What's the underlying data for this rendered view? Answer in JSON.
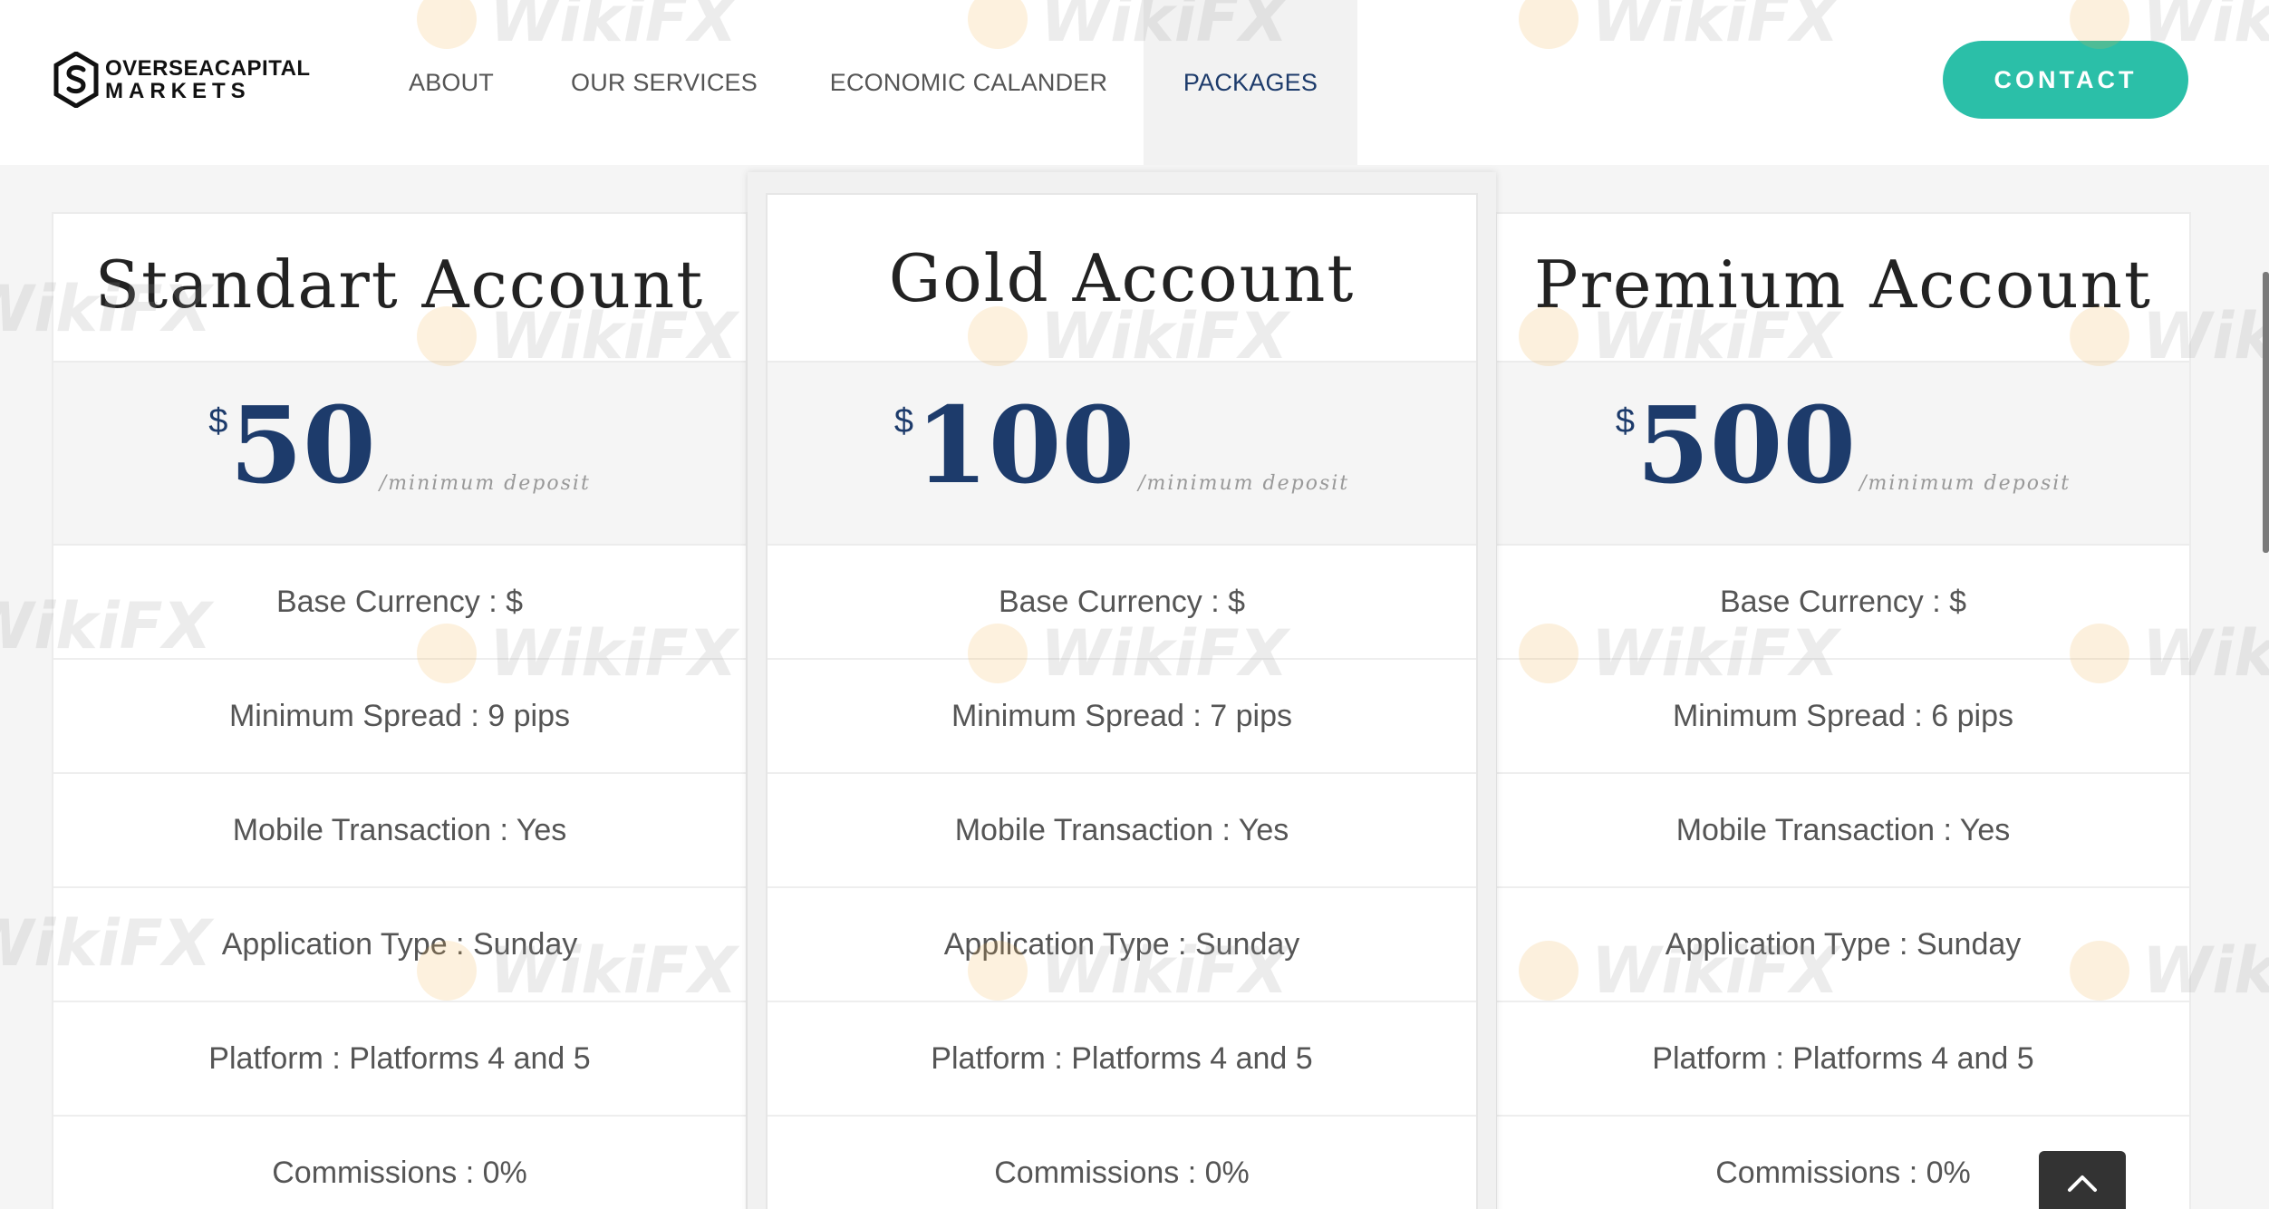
{
  "brand": {
    "name_line1": "OVERSEACAPITAL",
    "name_line2": "MARKETS"
  },
  "nav": {
    "items": [
      {
        "label": "ABOUT",
        "active": false
      },
      {
        "label": "OUR SERVICES",
        "active": false
      },
      {
        "label": "ECONOMIC CALANDER",
        "active": false
      },
      {
        "label": "PACKAGES",
        "active": true
      }
    ],
    "contact_label": "CONTACT"
  },
  "colors": {
    "accent": "#2bbfa8",
    "price_blue": "#1d3b6b"
  },
  "plans": [
    {
      "title": "Standart Account",
      "currency": "$",
      "amount": "50",
      "per": "/minimum deposit",
      "features": [
        "Base Currency : $",
        "Minimum Spread : 9 pips",
        "Mobile Transaction : Yes",
        "Application Type : Sunday",
        "Platform : Platforms 4 and 5",
        "Commissions : 0%"
      ]
    },
    {
      "title": "Gold Account",
      "currency": "$",
      "amount": "100",
      "per": "/minimum deposit",
      "features": [
        "Base Currency : $",
        "Minimum Spread : 7 pips",
        "Mobile Transaction : Yes",
        "Application Type : Sunday",
        "Platform : Platforms 4 and 5",
        "Commissions : 0%"
      ]
    },
    {
      "title": "Premium Account",
      "currency": "$",
      "amount": "500",
      "per": "/minimum deposit",
      "features": [
        "Base Currency : $",
        "Minimum Spread : 6 pips",
        "Mobile Transaction : Yes",
        "Application Type : Sunday",
        "Platform : Platforms 4 and 5",
        "Commissions : 0%"
      ]
    }
  ],
  "watermark": {
    "text": "WikiFX",
    "icon": "wikifx-logo-icon"
  },
  "scroll_top_icon": "chevron-up-icon"
}
